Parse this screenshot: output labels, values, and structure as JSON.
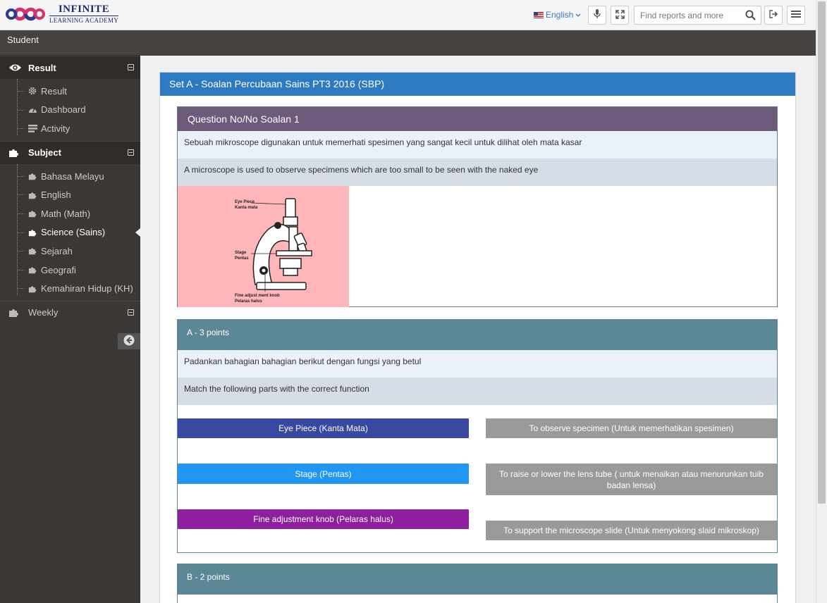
{
  "brand": {
    "title": "INFINITE",
    "subtitle": "LEARNING ACADEMY"
  },
  "topbar": {
    "language": "English",
    "search_placeholder": "Find reports and more"
  },
  "sidebar": {
    "user_label": "Student",
    "sections": {
      "result": {
        "label": "Result",
        "items": [
          "Result",
          "Dashboard",
          "Activity"
        ]
      },
      "subject": {
        "label": "Subject",
        "items": [
          "Bahasa Melayu",
          "English",
          "Math (Math)",
          "Science (Sains)",
          "Sejarah",
          "Geografi",
          "Kemahiran Hidup (KH)"
        ],
        "active": "Science (Sains)"
      },
      "weekly": {
        "label": "Weekly"
      }
    }
  },
  "panel": {
    "title": "Set A - Soalan Percubaan Sains PT3 2016 (SBP)",
    "question": {
      "header": "Question No/No Soalan 1",
      "text_ms": "Sebuah mikroscope digunakan untuk memerhati spesimen yang sangat kecil untuk dilihat oleh mata kasar",
      "text_en": "A microscope is used to observe specimens which are too small to be seen with the naked eye",
      "diagram_labels": {
        "eyepiece_en": "Eye Piece",
        "eyepiece_ms": "Kanta mata",
        "stage_en": "Stage",
        "stage_ms": "Pentas",
        "fine_en": "Fine adjust ment knob",
        "fine_ms": "Pelaras halus"
      }
    },
    "part_a": {
      "header": "A - 3 points",
      "text_ms": "Padankan bahagian bahagian berikut dengan fungsi yang betul",
      "text_en": "Match the following parts with the correct function",
      "left": [
        "Eye Piece (Kanta Mata)",
        "Stage (Pentas)",
        "Fine adjustment knob (Pelaras halus)"
      ],
      "right": [
        "To observe specimen (Untuk memerhatikan spesimen)",
        "To raise or lower the lens tube ( untuk menaikan atau menurunkan tuib badan lensa)",
        "To support the microscope slide (Untuk menyokong slaid mikroskop)"
      ]
    },
    "part_b": {
      "header": "B - 2 points"
    }
  },
  "colors": {
    "left_1": "#3749a0",
    "left_2": "#2196f3",
    "left_3": "#8e1f9e",
    "right": "#9a9a9a",
    "panel_header": "#2e7ac0",
    "question_header": "#6e5a7c",
    "section_header": "#5b8797"
  }
}
